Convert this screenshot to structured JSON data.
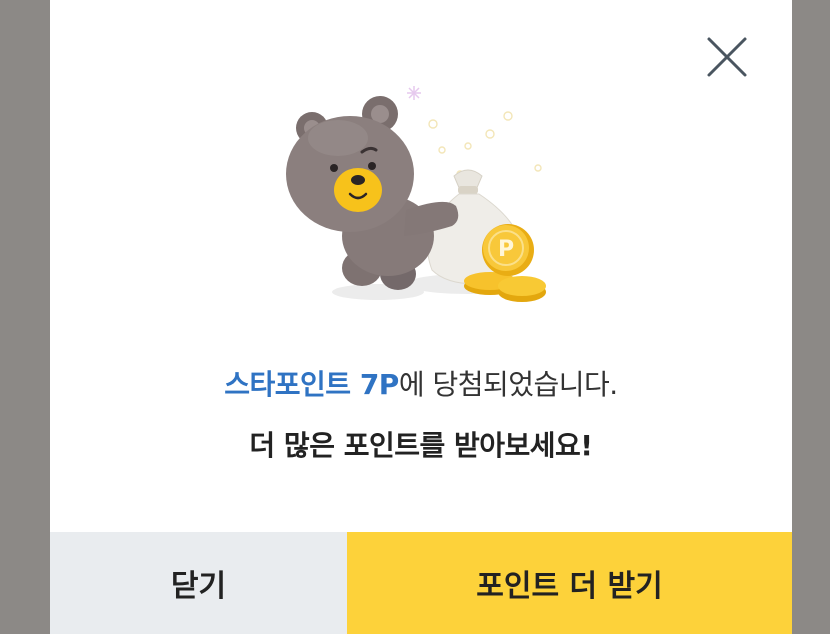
{
  "popup": {
    "message_highlight": "스타포인트 7P",
    "message_rest": "에 당첨되었습니다.",
    "sub_message": "더 많은 포인트를 받아보세요!",
    "close_label": "닫기",
    "more_points_label": "포인트 더 받기",
    "coin_letter": "P"
  },
  "colors": {
    "highlight": "#2f73c3",
    "primary_button": "#fdd23a",
    "secondary_button": "#e9ecef",
    "backdrop": "#8c8986"
  },
  "icons": [
    "close-icon",
    "bear-illustration",
    "money-bag-icon",
    "coin-icon",
    "sparkle-icon"
  ]
}
